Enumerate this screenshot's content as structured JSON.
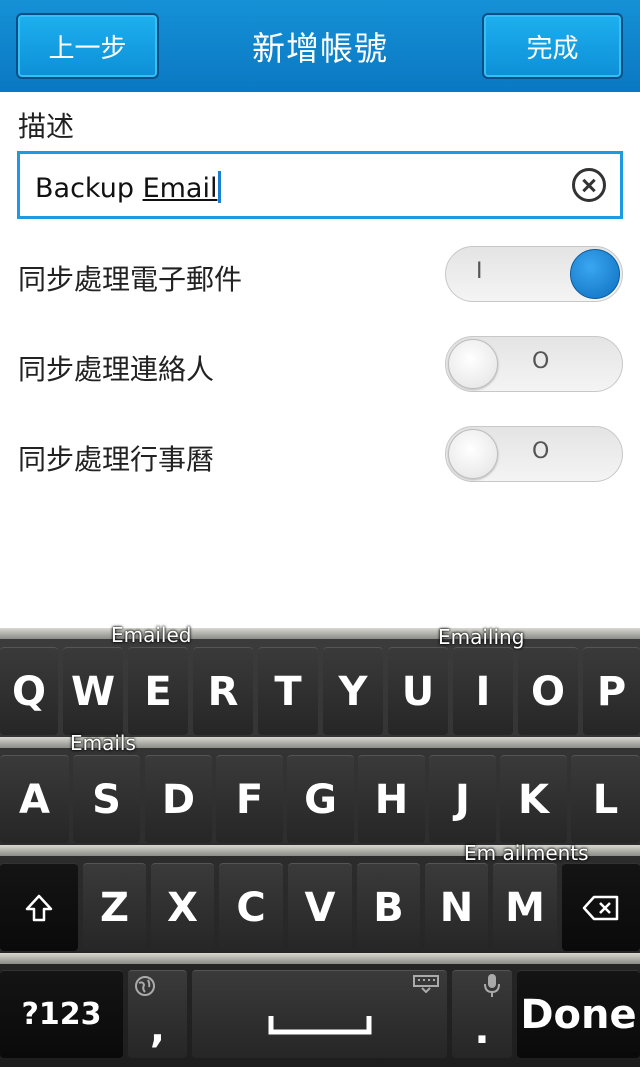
{
  "header": {
    "back_label": "上一步",
    "title": "新增帳號",
    "done_label": "完成"
  },
  "form": {
    "description_label": "描述",
    "description_value_part1": "Backup ",
    "description_value_part2": "Email",
    "toggles": [
      {
        "label": "同步處理電子郵件",
        "state": "on",
        "glyph": "I"
      },
      {
        "label": "同步處理連絡人",
        "state": "off",
        "glyph": "O"
      },
      {
        "label": "同步處理行事曆",
        "state": "off",
        "glyph": "O"
      }
    ]
  },
  "keyboard": {
    "suggestions": [
      "Emailed",
      "Emailing",
      "Emails",
      "Em ailments"
    ],
    "row1": [
      "Q",
      "W",
      "E",
      "R",
      "T",
      "Y",
      "U",
      "I",
      "O",
      "P"
    ],
    "row2": [
      "A",
      "S",
      "D",
      "F",
      "G",
      "H",
      "J",
      "K",
      "L"
    ],
    "row3": [
      "Z",
      "X",
      "C",
      "V",
      "B",
      "N",
      "M"
    ],
    "symbols_label": "?123",
    "comma_label": ",",
    "period_label": ".",
    "done_label": "Done",
    "icons": {
      "shift": "shift-icon",
      "backspace": "backspace-icon",
      "globe": "globe-icon",
      "keyboard": "keyboard-icon",
      "mic": "microphone-icon",
      "space": "space-icon"
    }
  },
  "colors": {
    "header_blue": "#0a78c2",
    "accent_blue": "#1c9be4",
    "toggle_on": "#0d6fc0"
  }
}
